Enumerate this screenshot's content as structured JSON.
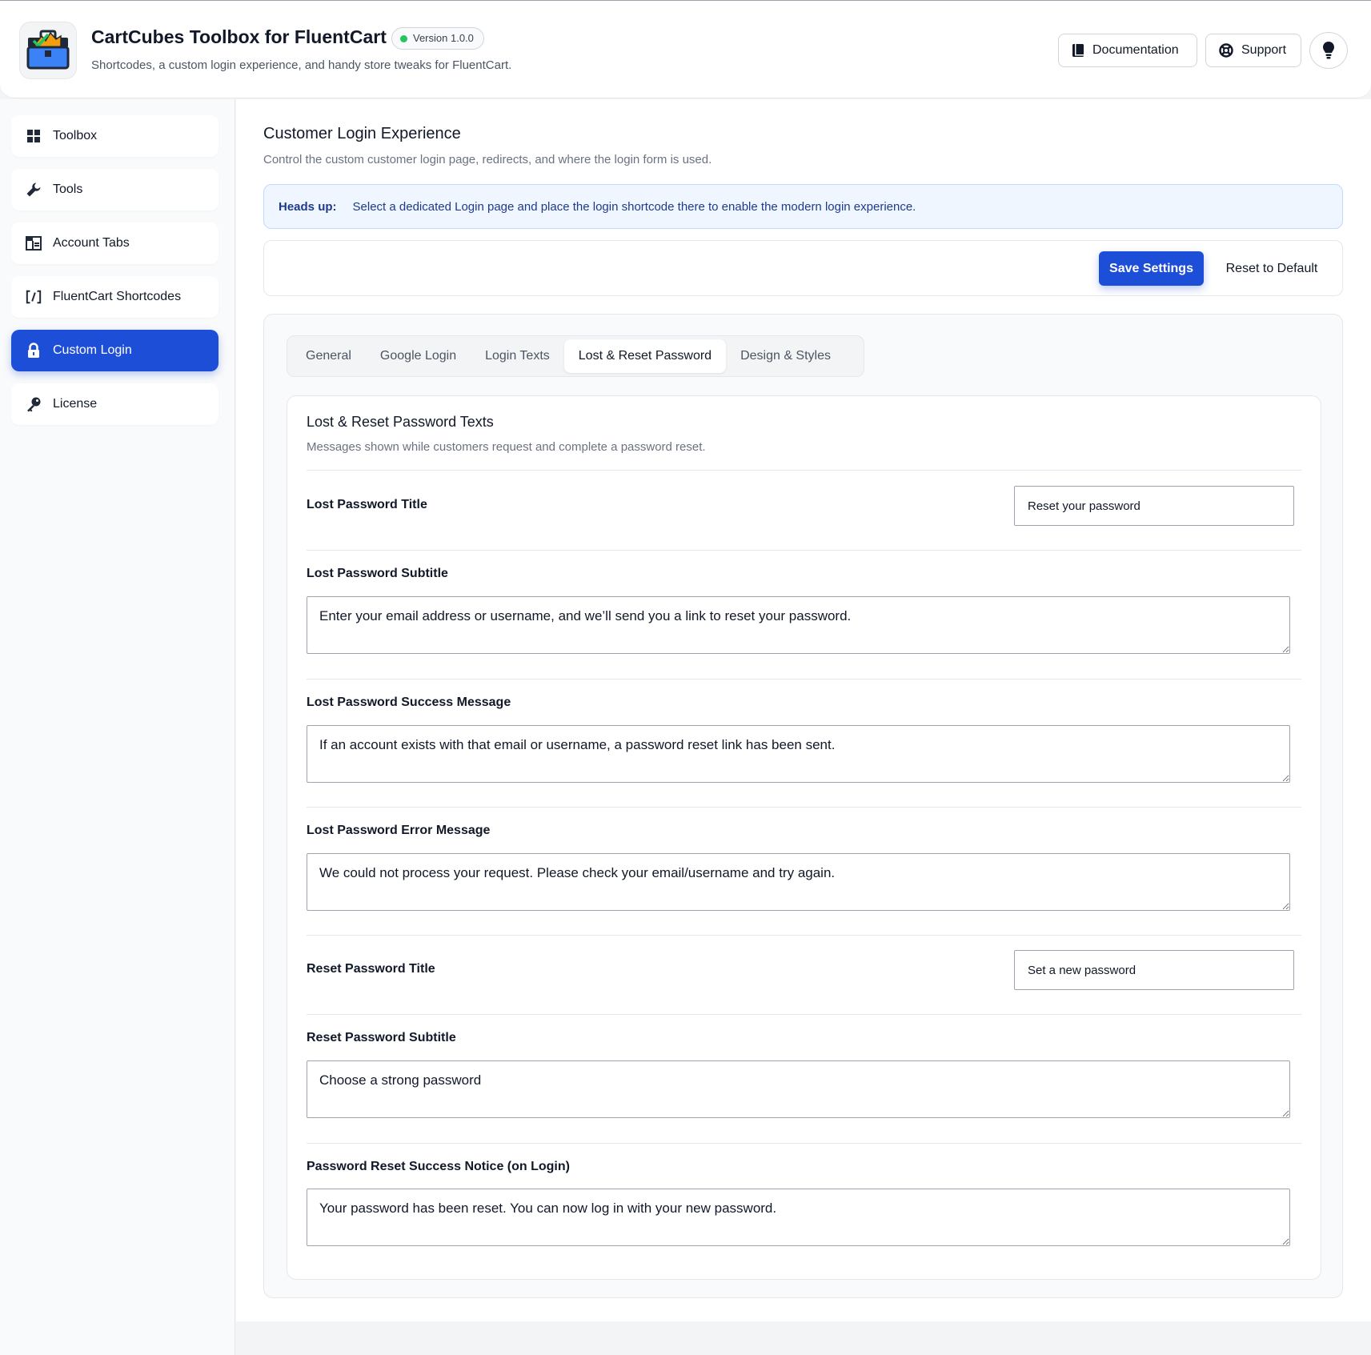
{
  "header": {
    "title": "CartCubes Toolbox for FluentCart",
    "version": "Version 1.0.0",
    "subtitle": "Shortcodes, a custom login experience, and handy store tweaks for FluentCart.",
    "documentation_label": "Documentation",
    "support_label": "Support",
    "logo_icon": "toolbox-icon",
    "status_color": "#22c55e"
  },
  "sidebar": {
    "items": [
      {
        "label": "Toolbox",
        "icon": "grid-icon",
        "active": false
      },
      {
        "label": "Tools",
        "icon": "wrench-icon",
        "active": false
      },
      {
        "label": "Account Tabs",
        "icon": "tabs-icon",
        "active": false
      },
      {
        "label": "FluentCart Shortcodes",
        "icon": "shortcode-icon",
        "active": false
      },
      {
        "label": "Custom Login",
        "icon": "lock-icon",
        "active": true
      },
      {
        "label": "License",
        "icon": "key-icon",
        "active": false
      }
    ],
    "accent_color": "#1d4ed8"
  },
  "main": {
    "title": "Customer Login Experience",
    "subtitle": "Control the custom customer login page, redirects, and where the login form is used.",
    "notice": {
      "label": "Heads up:",
      "text": "Select a dedicated Login page and place the login shortcode there to enable the modern login experience."
    },
    "actions": {
      "save_label": "Save Settings",
      "reset_label": "Reset to Default"
    },
    "tabs": [
      {
        "label": "General",
        "active": false
      },
      {
        "label": "Google Login",
        "active": false
      },
      {
        "label": "Login Texts",
        "active": false
      },
      {
        "label": "Lost & Reset Password",
        "active": true
      },
      {
        "label": "Design & Styles",
        "active": false
      }
    ],
    "card": {
      "title": "Lost & Reset Password Texts",
      "subtitle": "Messages shown while customers request and complete a password reset.",
      "fields": {
        "lost_title": {
          "label": "Lost Password Title",
          "value": "Reset your password"
        },
        "lost_subtitle": {
          "label": "Lost Password Subtitle",
          "value": "Enter your email address or username, and we’ll send you a link to reset your password."
        },
        "lost_success": {
          "label": "Lost Password Success Message",
          "value": "If an account exists with that email or username, a password reset link has been sent."
        },
        "lost_error": {
          "label": "Lost Password Error Message",
          "value": "We could not process your request. Please check your email/username and try again."
        },
        "reset_title": {
          "label": "Reset Password Title",
          "value": "Set a new password"
        },
        "reset_subtitle": {
          "label": "Reset Password Subtitle",
          "value": "Choose a strong password"
        },
        "reset_success_notice": {
          "label": "Password Reset Success Notice (on Login)",
          "value": "Your password has been reset. You can now log in with your new password."
        }
      }
    }
  }
}
